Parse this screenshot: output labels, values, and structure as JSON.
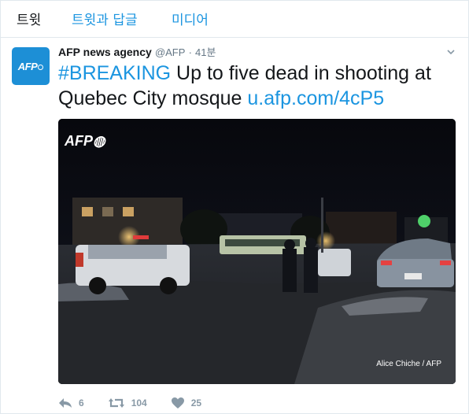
{
  "tabs": [
    {
      "label": "트윗"
    },
    {
      "label": "트윗과 답글"
    },
    {
      "label": "미디어"
    }
  ],
  "tweet": {
    "author_name": "AFP news agency",
    "handle": "@AFP",
    "separator": "·",
    "time": "41분",
    "hashtag": "#BREAKING",
    "body": " Up to five dead in shooting at Quebec City mosque ",
    "link": "u.afp.com/4cP5",
    "photo_watermark": "AFP",
    "photo_credit": "Alice Chiche / AFP",
    "actions": {
      "reply_count": "6",
      "retweet_count": "104",
      "like_count": "25"
    }
  },
  "colors": {
    "link": "#1b95e0",
    "avatar_bg": "#1d8fd6",
    "muted": "#657786"
  }
}
